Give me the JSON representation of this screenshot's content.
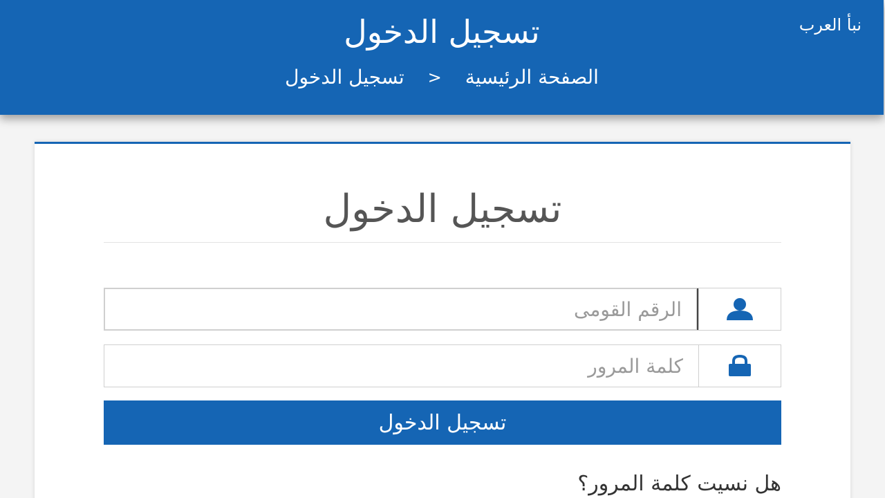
{
  "header": {
    "title": "تسجيل الدخول",
    "breadcrumb": {
      "home": "الصفحة الرئيسية",
      "separator": ">",
      "current": "تسجيل الدخول"
    }
  },
  "watermark": "نبأ العرب",
  "login_card": {
    "title": "تسجيل الدخول",
    "national_id": {
      "placeholder": "الرقم القومى",
      "value": "",
      "icon": "user-icon"
    },
    "password": {
      "placeholder": "كلمة المرور",
      "value": "",
      "icon": "lock-icon"
    },
    "submit_label": "تسجيل الدخول",
    "forgot_password": "هل نسيت كلمة المرور؟"
  },
  "colors": {
    "brand": "#1565b4",
    "card_bg": "#ffffff",
    "page_bg": "#f4f4f4",
    "placeholder": "#9a9a9a"
  }
}
